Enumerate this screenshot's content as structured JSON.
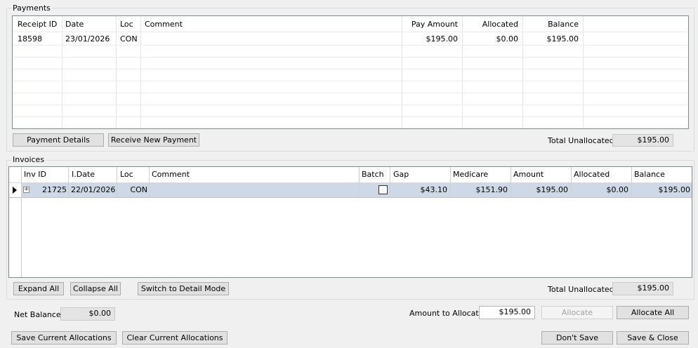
{
  "payments": {
    "title": "Payments",
    "columns": [
      "Receipt ID",
      "Date",
      "Loc",
      "Comment",
      "Pay Amount",
      "Allocated",
      "Balance"
    ],
    "rows": [
      {
        "receipt_id": "18598",
        "date": "23/01/2026",
        "loc": "CON",
        "comment": "",
        "pay_amount": "$195.00",
        "allocated": "$0.00",
        "balance": "$195.00"
      }
    ],
    "buttons": {
      "payment_details": "Payment Details",
      "receive_new_payment": "Receive New Payment"
    },
    "total_unallocated_label": "Total Unallocated",
    "total_unallocated_value": "$195.00"
  },
  "invoices": {
    "title": "Invoices",
    "columns": [
      "Inv ID",
      "I.Date",
      "Loc",
      "Comment",
      "Batch",
      "Gap",
      "Medicare",
      "Amount",
      "Allocated",
      "Balance"
    ],
    "rows": [
      {
        "expand": "+",
        "inv_id": "21725",
        "date": "22/01/2026",
        "loc": "CON",
        "comment": "",
        "batch": false,
        "gap": "$43.10",
        "medicare": "$151.90",
        "amount": "$195.00",
        "allocated": "$0.00",
        "balance": "$195.00"
      }
    ],
    "buttons": {
      "expand_all": "Expand All",
      "collapse_all": "Collapse All",
      "switch_mode": "Switch to Detail Mode"
    },
    "total_unallocated_label": "Total Unallocated",
    "total_unallocated_value": "$195.00"
  },
  "footer": {
    "net_balance_label": "Net Balance",
    "net_balance_value": "$0.00",
    "amount_to_allocate_label": "Amount to Allocate",
    "amount_to_allocate_value": "$195.00",
    "allocate": "Allocate",
    "allocate_all": "Allocate All",
    "save_current": "Save Current Allocations",
    "clear_current": "Clear Current Allocations",
    "dont_save": "Don't Save",
    "save_close": "Save & Close"
  }
}
